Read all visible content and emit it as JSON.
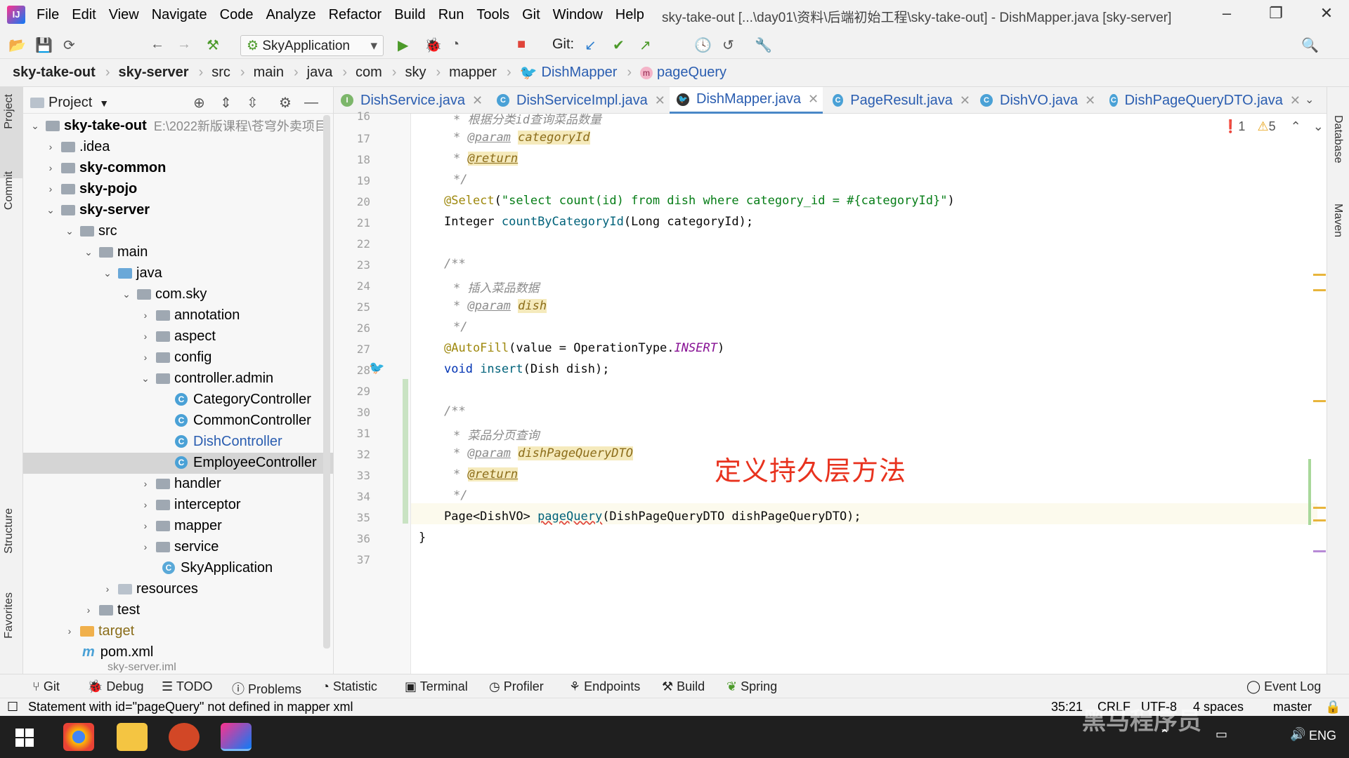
{
  "menu": [
    "File",
    "Edit",
    "View",
    "Navigate",
    "Code",
    "Analyze",
    "Refactor",
    "Build",
    "Run",
    "Tools",
    "Git",
    "Window",
    "Help"
  ],
  "window_title": "sky-take-out [...\\day01\\资料\\后端初始工程\\sky-take-out] - DishMapper.java [sky-server]",
  "run_config": "SkyApplication",
  "git_label": "Git:",
  "breadcrumb": [
    "sky-take-out",
    "sky-server",
    "src",
    "main",
    "java",
    "com",
    "sky",
    "mapper",
    "DishMapper",
    "pageQuery"
  ],
  "left_strip": {
    "project": "Project",
    "commit": "Commit",
    "structure": "Structure",
    "favorites": "Favorites"
  },
  "right_strip": {
    "database": "Database",
    "maven": "Maven"
  },
  "project_panel": {
    "title": "Project",
    "root_name": "sky-take-out",
    "root_path": "E:\\2022新版课程\\苍穹外卖项目",
    "items": [
      ".idea",
      "sky-common",
      "sky-pojo",
      "sky-server",
      "src",
      "main",
      "java",
      "com.sky",
      "annotation",
      "aspect",
      "config",
      "controller.admin",
      "CategoryController",
      "CommonController",
      "DishController",
      "EmployeeController",
      "handler",
      "interceptor",
      "mapper",
      "service",
      "SkyApplication",
      "resources",
      "test",
      "target",
      "pom.xml",
      "sky-server.iml"
    ]
  },
  "tabs": [
    "DishService.java",
    "DishServiceImpl.java",
    "DishMapper.java",
    "PageResult.java",
    "DishVO.java",
    "DishPageQueryDTO.java"
  ],
  "inspections": {
    "errors": "1",
    "warnings": "5"
  },
  "code": {
    "line_numbers": [
      "16",
      "17",
      "18",
      "19",
      "20",
      "21",
      "22",
      "23",
      "24",
      "25",
      "26",
      "27",
      "28",
      "29",
      "30",
      "31",
      "32",
      "33",
      "34",
      "35",
      "36",
      "37"
    ],
    "l16": "* 根据分类id查询菜品数量",
    "star": "*",
    "param_tag": "@param",
    "return_tag": "@return",
    "p17": "categoryId",
    "end_doc": "*/",
    "open_doc": "/**",
    "l20_ann": "@Select",
    "l20_str": "\"select count(id) from dish where category_id = #{categoryId}\"",
    "l21_type": "Integer ",
    "l21_fn": "countByCategoryId",
    "l21_rest": "(Long categoryId);",
    "l24": "* 插入菜品数据",
    "p25": "dish",
    "l27_ann": "@AutoFill",
    "l27_mid": "(value = OperationType.",
    "l27_const": "INSERT",
    "l27_end": ")",
    "l28_kw": "void ",
    "l28_fn": "insert",
    "l28_rest": "(Dish dish);",
    "l31": "* 菜品分页查询",
    "p32": "dishPageQueryDTO",
    "l35_type": "Page<DishVO> ",
    "l35_fn": "pageQuery",
    "l35_rest": "(DishPageQueryDTO dishPageQueryDTO);",
    "l36": "}"
  },
  "overlay_text": "定义持久层方法",
  "bottom_tools": [
    "Git",
    "Debug",
    "TODO",
    "Problems",
    "Statistic",
    "Terminal",
    "Profiler",
    "Endpoints",
    "Build",
    "Spring",
    "Event Log"
  ],
  "status": {
    "message": "Statement with id=\"pageQuery\" not defined in mapper xml",
    "position": "35:21",
    "line_sep": "CRLF",
    "encoding": "UTF-8",
    "indent": "4 spaces",
    "branch": "master"
  },
  "taskbar": {
    "lang": "ENG"
  },
  "watermark": "黑马程序员"
}
